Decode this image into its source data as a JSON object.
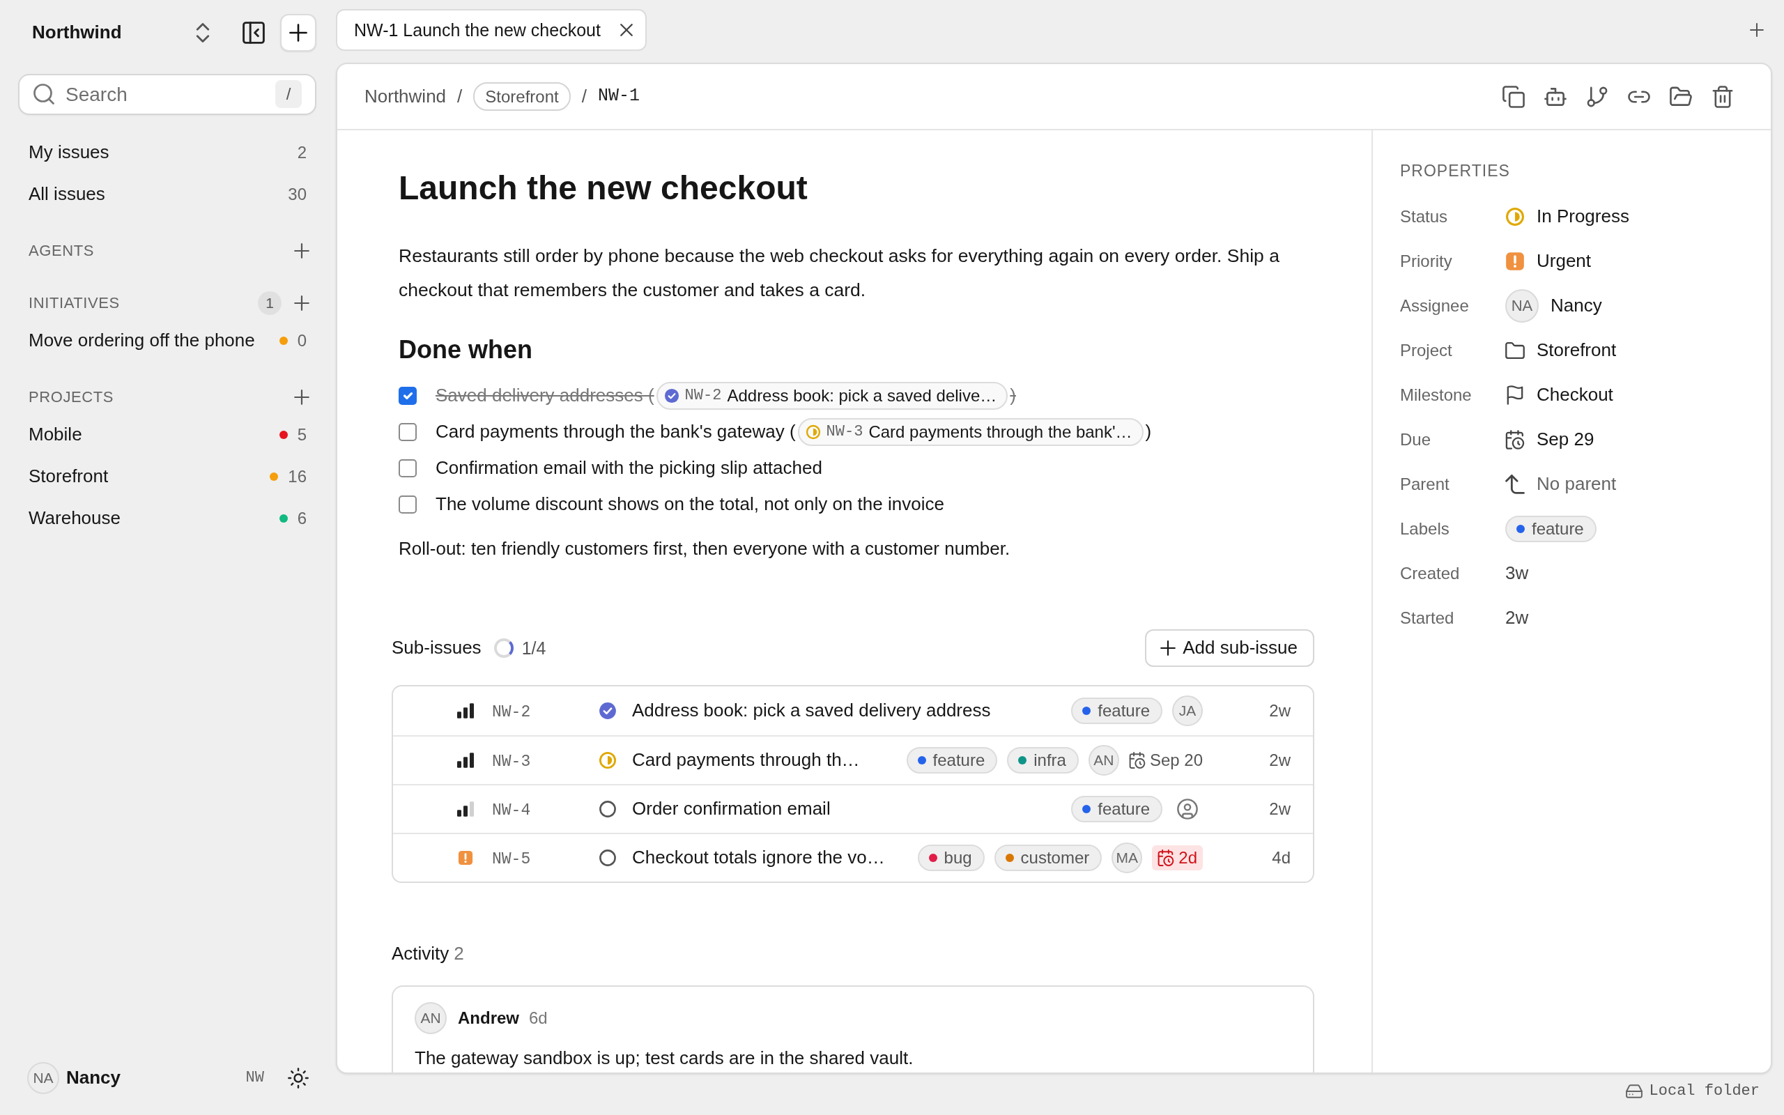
{
  "workspace": {
    "name": "Northwind"
  },
  "search": {
    "placeholder": "Search",
    "shortcut": "/"
  },
  "nav": [
    {
      "label": "My issues",
      "count": "2"
    },
    {
      "label": "All issues",
      "count": "30"
    }
  ],
  "sections": [
    {
      "title": "AGENTS"
    },
    {
      "title": "INITIATIVES",
      "badge": "1",
      "items": [
        {
          "label": "Move ordering off the phone",
          "color": "#f59e0b",
          "count": "0"
        }
      ]
    },
    {
      "title": "PROJECTS",
      "items": [
        {
          "label": "Mobile",
          "color": "#e5141e",
          "count": "5"
        },
        {
          "label": "Storefront",
          "color": "#f59e0b",
          "count": "16"
        },
        {
          "label": "Warehouse",
          "color": "#12b981",
          "count": "6"
        }
      ]
    }
  ],
  "user": {
    "initials": "NA",
    "name": "Nancy",
    "workspace_code": "NW"
  },
  "tabs": [
    {
      "label": "NW-1 Launch the new checkout",
      "selected": true
    }
  ],
  "breadcrumb": [
    {
      "kind": "link",
      "label": "Northwind"
    },
    {
      "kind": "separator",
      "label": "/"
    },
    {
      "kind": "pill",
      "label": "Storefront"
    },
    {
      "kind": "separator",
      "label": "/"
    },
    {
      "kind": "id",
      "label": "NW-1"
    }
  ],
  "issue": {
    "title": "Launch the new checkout",
    "description": "Restaurants still order by phone because the web checkout asks for everything again on every order. Ship a checkout that remembers the customer and takes a card.",
    "checklist_heading": "Done when",
    "checklist": [
      {
        "checked": true,
        "text": "Saved delivery addresses (",
        "ref": {
          "status": {
            "kind": "done"
          },
          "id": "NW-2",
          "title": "Address book: pick a saved delive…"
        },
        "close": ")"
      },
      {
        "checked": false,
        "text": "Card payments through the bank's gateway (",
        "ref": {
          "status": {
            "kind": "in_progress"
          },
          "id": "NW-3",
          "title": "Card payments through the bank'…"
        },
        "close": ")"
      },
      {
        "checked": false,
        "text": "Confirmation email with the picking slip attached"
      },
      {
        "checked": false,
        "text": "The volume discount shows on the total, not only on the invoice"
      }
    ],
    "note": "Roll-out: ten friendly customers first, then everyone with a customer number."
  },
  "sub_issues": {
    "heading": "Sub-issues",
    "level": 0.25,
    "progress": "1/4",
    "add_label": "Add sub-issue",
    "rows": [
      {
        "priority": {
          "kind": "high"
        },
        "id": "NW-2",
        "status": {
          "kind": "done"
        },
        "title": "Address book: pick a saved delivery address",
        "labels": [
          {
            "name": "feature",
            "color": "#2563eb"
          }
        ],
        "assignee": {
          "kind": "avatar",
          "initials": "JA"
        },
        "age": "2w"
      },
      {
        "priority": {
          "kind": "high"
        },
        "id": "NW-3",
        "status": {
          "kind": "in_progress"
        },
        "title": "Card payments through th…",
        "labels": [
          {
            "name": "feature",
            "color": "#2563eb"
          },
          {
            "name": "infra",
            "color": "#0f9488"
          }
        ],
        "assignee": {
          "kind": "avatar",
          "initials": "AN"
        },
        "due": {
          "text": "Sep 20",
          "overdue": false
        },
        "age": "2w"
      },
      {
        "priority": {
          "kind": "medium"
        },
        "id": "NW-4",
        "status": {
          "kind": "todo"
        },
        "title": "Order confirmation email",
        "labels": [
          {
            "name": "feature",
            "color": "#2563eb"
          }
        ],
        "assignee": {
          "kind": "unassigned"
        },
        "age": "2w"
      },
      {
        "priority": {
          "kind": "urgent"
        },
        "id": "NW-5",
        "status": {
          "kind": "todo"
        },
        "title": "Checkout totals ignore the vo…",
        "labels": [
          {
            "name": "bug",
            "color": "#e11d48"
          },
          {
            "name": "customer",
            "color": "#d97706"
          }
        ],
        "assignee": {
          "kind": "avatar",
          "initials": "MA"
        },
        "due": {
          "text": "2d",
          "overdue": true
        },
        "age": "4d"
      }
    ]
  },
  "activity": {
    "heading": "Activity",
    "count": "2",
    "comments": [
      {
        "initials": "AN",
        "author": "Andrew",
        "time": "6d",
        "text": "The gateway sandbox is up; test cards are in the shared vault."
      }
    ]
  },
  "properties": {
    "heading": "PROPERTIES",
    "rows": [
      {
        "label": "Status",
        "kind": "status",
        "status": {
          "kind": "in_progress"
        },
        "value": "In Progress",
        "empty": false
      },
      {
        "label": "Priority",
        "kind": "priority",
        "priority": {
          "kind": "urgent"
        },
        "value": "Urgent",
        "empty": false
      },
      {
        "label": "Assignee",
        "kind": "person",
        "initials": "NA",
        "value": "Nancy",
        "empty": false
      },
      {
        "label": "Project",
        "kind": "project",
        "value": "Storefront",
        "empty": false
      },
      {
        "label": "Milestone",
        "kind": "milestone",
        "value": "Checkout",
        "empty": false
      },
      {
        "label": "Due",
        "kind": "date",
        "value": "Sep 29",
        "empty": false
      },
      {
        "label": "Parent",
        "kind": "parent",
        "value": "No parent",
        "empty": true
      },
      {
        "label": "Labels",
        "kind": "labels",
        "labels": [
          {
            "name": "feature",
            "color": "#2563eb"
          }
        ]
      },
      {
        "label": "Created",
        "kind": "plain",
        "value": "3w",
        "empty": false
      },
      {
        "label": "Started",
        "kind": "plain",
        "value": "2w",
        "empty": false
      }
    ]
  },
  "status_bar": {
    "location": "Local folder"
  }
}
